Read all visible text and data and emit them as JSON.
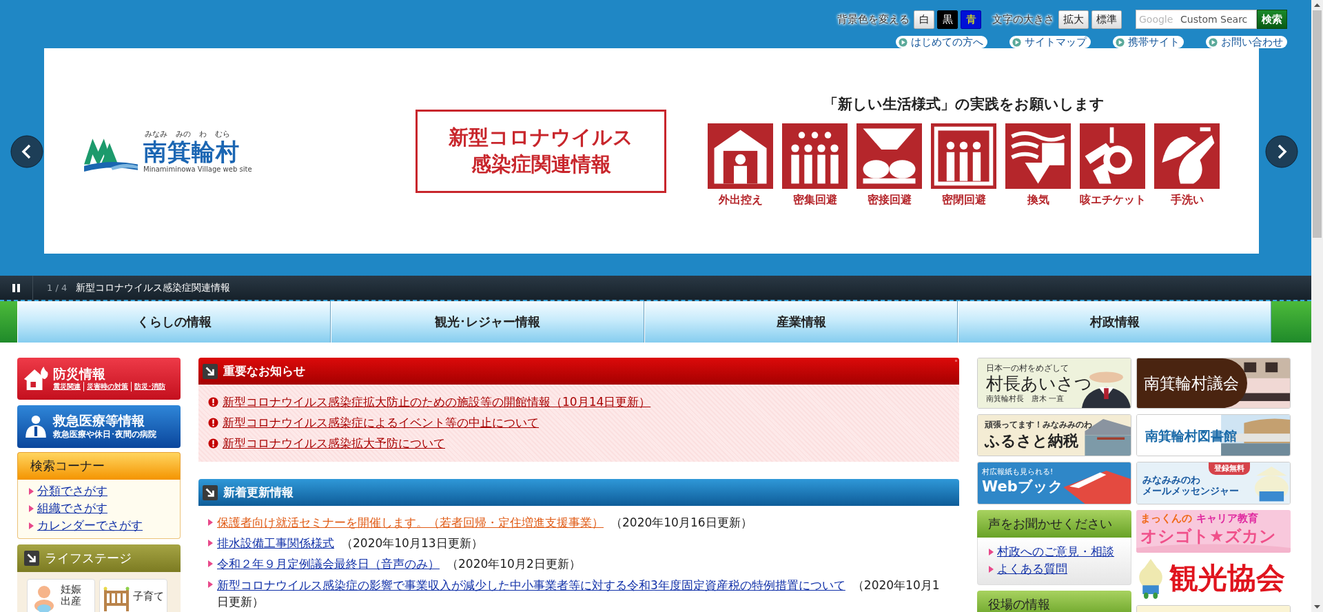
{
  "top_bar": {
    "background": {
      "label": "背景色を変える",
      "options": [
        {
          "label": "白",
          "kind": "white"
        },
        {
          "label": "黒",
          "kind": "black"
        },
        {
          "label": "青",
          "kind": "blue"
        }
      ]
    },
    "text_size": {
      "label": "文字の大きさ",
      "options": [
        "拡大",
        "標準"
      ]
    },
    "search": {
      "logo": "Google",
      "placeholder": "Custom Searc",
      "button": "検索"
    }
  },
  "quick_links": [
    "はじめての方へ",
    "サイトマップ",
    "携帯サイト",
    "お問い合わせ"
  ],
  "banner": {
    "logo": {
      "kana": [
        "みなみ",
        "みの",
        "わ",
        "むら"
      ],
      "name": "南箕輪村",
      "subtitle": "Minamiminowa Village web site"
    },
    "notice": [
      "新型コロナウイルス",
      "感染症関連情報"
    ],
    "headline": "「新しい生活様式」の実践をお願いします",
    "pictograms": [
      "外出控え",
      "密集回避",
      "密接回避",
      "密閉回避",
      "換気",
      "咳エチケット",
      "手洗い"
    ]
  },
  "slider": {
    "counter": "1 / 4",
    "caption": "新型コロナウイルス感染症関連情報"
  },
  "nav": [
    "くらしの情報",
    "観光･レジャー情報",
    "産業情報",
    "村政情報"
  ],
  "left": {
    "disaster": {
      "title": "防災情報",
      "links": [
        "震災関連",
        "災害時の対策",
        "防災･消防"
      ]
    },
    "medical": {
      "title": "救急医療等情報",
      "subtitle": "救急医療や休日･夜間の病院"
    },
    "search_corner": {
      "title": "検索コーナー",
      "links": [
        "分類でさがす",
        "組織でさがす",
        "カレンダーでさがす"
      ]
    },
    "life_stage": {
      "title": "ライフステージ",
      "items": [
        "妊娠出産",
        "子育て"
      ]
    }
  },
  "important": {
    "title": "重要なお知らせ",
    "items": [
      "新型コロナウイルス感染症拡大防止のための施設等の開館情報（10月14日更新）",
      "新型コロナウイルス感染症によるイベント等の中止について",
      "新型コロナウイルス感染拡大予防について"
    ]
  },
  "updates": {
    "title": "新着更新情報",
    "items": [
      {
        "link": "保護者向け就活セミナーを開催します。（若者回帰・定住増進支援事業）",
        "date": "（2020年10月16日更新）",
        "highlighted": true
      },
      {
        "link": "排水設備工事関係様式",
        "date": "（2020年10月13日更新）",
        "highlighted": false
      },
      {
        "link": "令和２年９月定例議会最終日（音声のみ）",
        "date": "（2020年10月2日更新）",
        "highlighted": false
      },
      {
        "link": "新型コロナウイルス感染症の影響で事業収入が減少した中小事業者等に対する令和3年度固定資産税の特例措置について",
        "date": "（2020年10月1日更新）",
        "highlighted": false
      }
    ]
  },
  "right": {
    "column_1": [
      {
        "kind": "mayor",
        "lines": [
          "日本一の村をめざして",
          "村長あいさつ",
          "南箕輪村長　唐木 一直"
        ]
      },
      {
        "kind": "furusato",
        "lines": [
          "頑張ってます！みなみみのわ",
          "ふるさと納税"
        ]
      },
      {
        "kind": "webbook",
        "lines": [
          "村広報紙も見られる!",
          "Webブック"
        ]
      },
      {
        "kind": "panel",
        "title": "声をお聞かせください",
        "links": [
          "村政へのご意見・相談",
          "よくある質問"
        ]
      },
      {
        "kind": "panel",
        "title": "役場の情報"
      }
    ],
    "column_2": [
      {
        "kind": "council",
        "lines": [
          "南箕輪村議会"
        ]
      },
      {
        "kind": "library",
        "lines": [
          "南箕輪村図書館"
        ]
      },
      {
        "kind": "mail",
        "lines": [
          "登録無料",
          "みなみみのわ",
          "メールメッセンジャー"
        ]
      },
      {
        "kind": "career",
        "lines": [
          "まっくんの",
          "キャリア教育",
          "オシゴト★ズカン"
        ]
      },
      {
        "kind": "tourism",
        "lines": [
          "観光協会"
        ]
      },
      {
        "kind": "picture"
      }
    ]
  }
}
